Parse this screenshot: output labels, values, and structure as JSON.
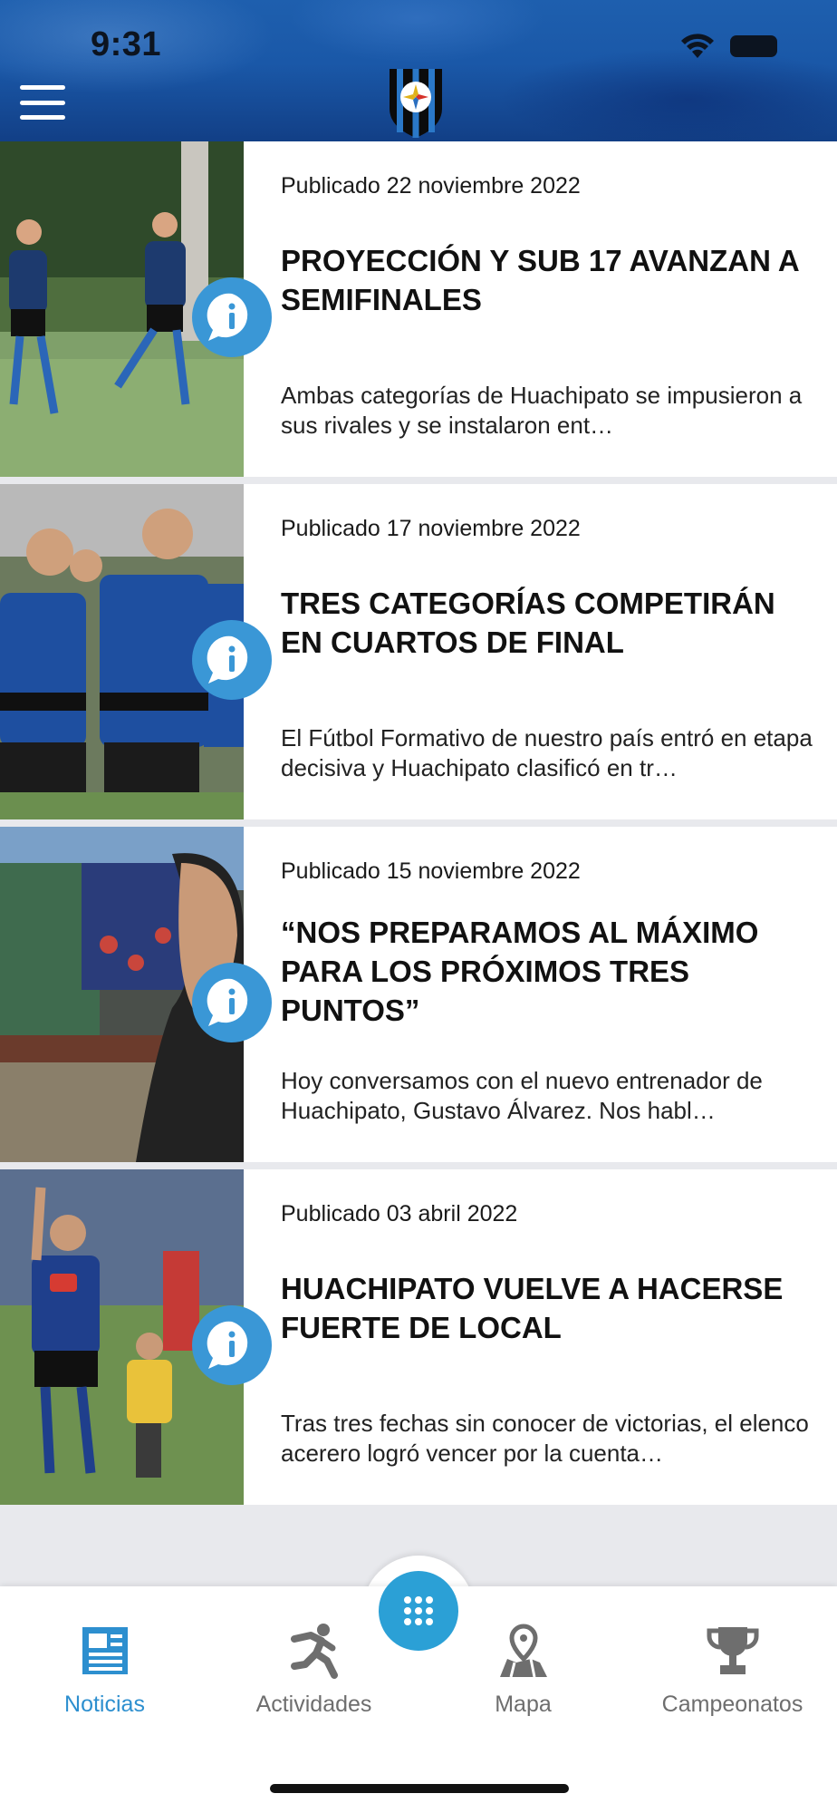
{
  "status_bar": {
    "time": "9:31"
  },
  "header": {
    "menu_icon": "hamburger-menu-icon",
    "logo": "club-crest"
  },
  "news": [
    {
      "date": "Publicado 22 noviembre 2022",
      "title": "PROYECCIÓN Y SUB 17 AVANZAN A SEMIFINALES",
      "excerpt": "Ambas categorías de Huachipato se impusieron a sus rivales y se instalaron ent…"
    },
    {
      "date": "Publicado 17 noviembre 2022",
      "title": "TRES CATEGORÍAS COMPETIRÁN EN CUARTOS DE FINAL",
      "excerpt": "El Fútbol Formativo de nuestro país entró en etapa decisiva y Huachipato clasificó en tr…"
    },
    {
      "date": "Publicado 15 noviembre 2022",
      "title": "“NOS PREPARAMOS AL MÁXIMO PARA LOS PRÓXIMOS TRES PUNTOS”",
      "excerpt": "Hoy conversamos con el nuevo entrenador de Huachipato, Gustavo Álvarez. Nos habl…"
    },
    {
      "date": "Publicado 03 abril 2022",
      "title": "HUACHIPATO VUELVE A HACERSE FUERTE DE LOCAL",
      "excerpt": "Tras tres fechas sin conocer de victorias, el elenco acerero logró vencer por la cuenta…"
    }
  ],
  "tabbar": {
    "tabs": [
      {
        "label": "Noticias",
        "icon": "newspaper-icon",
        "active": true
      },
      {
        "label": "Actividades",
        "icon": "running-person-icon",
        "active": false
      },
      {
        "label": "Mapa",
        "icon": "map-pin-icon",
        "active": false
      },
      {
        "label": "Campeonatos",
        "icon": "trophy-icon",
        "active": false
      }
    ],
    "fab_icon": "grid-dots-icon"
  },
  "colors": {
    "accent": "#2d8fcf",
    "badge": "#3a97d6",
    "header_blue": "#1a58a8",
    "tab_inactive": "#6e6e6e"
  }
}
